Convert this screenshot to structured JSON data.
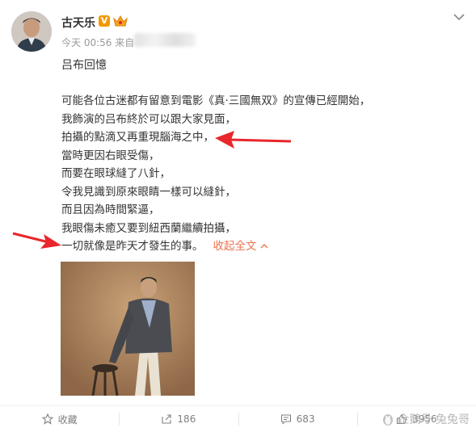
{
  "user": {
    "name": "古天乐",
    "v_badge": "V"
  },
  "meta": {
    "time": "今天 00:56",
    "source_prefix": "来自"
  },
  "post": {
    "title": "吕布回憶",
    "lines": [
      "可能各位古迷都有留意到電影《真·三國無双》的宣傳已經開始，",
      "我飾演的吕布終於可以跟大家見面，",
      "拍攝的點滴又再重現腦海之中，",
      "當時更因右眼受傷，",
      "而要在眼球縫了八針，",
      "令我見識到原來眼睛一樣可以縫針，",
      "而且因為時間緊逼，",
      "我眼傷未癒又要到紐西蘭繼續拍攝，",
      "一切就像是昨天才發生的事。"
    ],
    "collapse_label": "收起全文"
  },
  "actions": {
    "favorite_label": "收藏",
    "repost_count": "186",
    "comment_count": "683",
    "like_count": "3956"
  },
  "watermark": "企鵝号 兔兔哥",
  "colors": {
    "accent": "#eb7350",
    "annotation_arrow": "#e8262b",
    "v_badge": "#f39800"
  },
  "icons": [
    "avatar",
    "v-badge-icon",
    "crown-icon",
    "chevron-down-icon",
    "arrow-annotation-icon",
    "favorite-icon",
    "repost-icon",
    "comment-icon",
    "like-icon",
    "penguin-logo-icon"
  ]
}
